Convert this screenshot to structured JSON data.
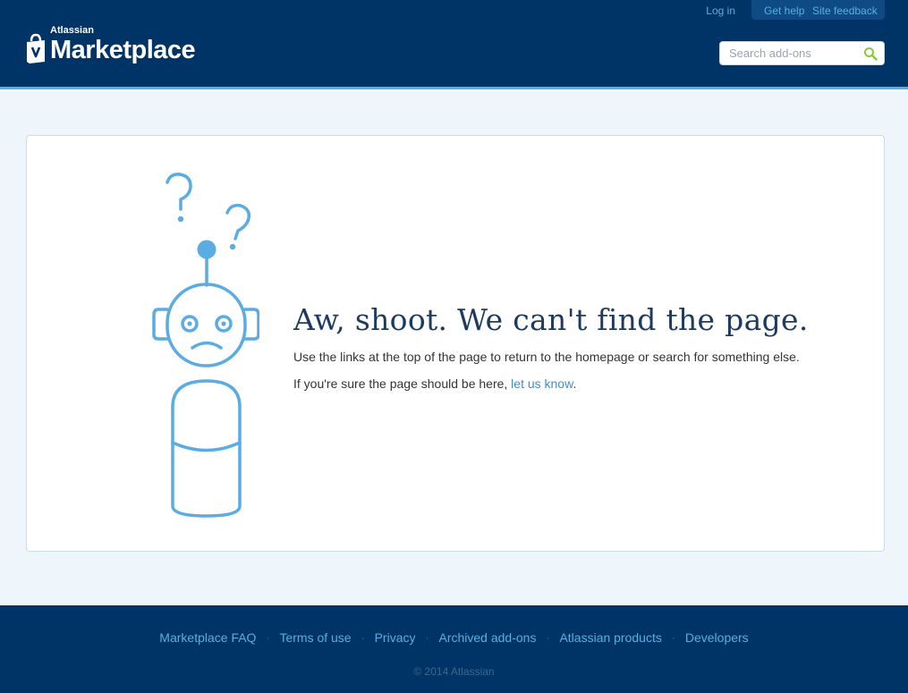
{
  "header": {
    "login_label": "Log in",
    "get_help_label": "Get help",
    "site_feedback_label": "Site feedback",
    "logo_small": "Atlassian",
    "logo_large": "Marketplace",
    "search_placeholder": "Search add-ons"
  },
  "main": {
    "headline": "Aw, shoot. We can't find the page.",
    "instruction": "Use the links at the top of the page to return to the homepage or search for something else.",
    "sure_prefix": "If you're sure the page should be here,",
    "let_us_know_label": "let us know",
    "sure_suffix": "."
  },
  "footer": {
    "links": [
      "Marketplace FAQ",
      "Terms of use",
      "Privacy",
      "Archived add-ons",
      "Atlassian products",
      "Developers"
    ],
    "separator": "·",
    "copyright": "© 2014 Atlassian"
  },
  "colors": {
    "header_bg": "#003366",
    "accent": "#59afe1",
    "page_bg": "#eef5fb",
    "headline": "#1f3a5f",
    "search_icon": "#8dc63f"
  },
  "icons": {
    "search": "search-icon",
    "logo": "shopping-bag-logo-icon",
    "illustration": "confused-robot-illustration"
  }
}
